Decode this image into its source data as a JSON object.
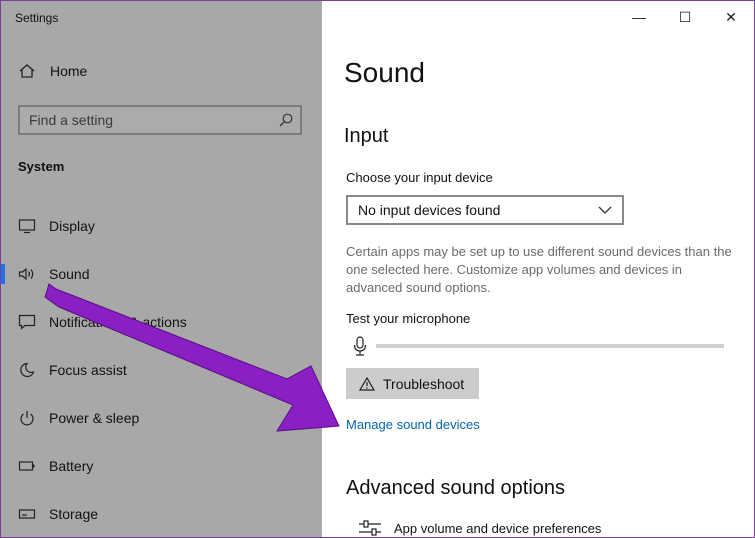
{
  "window": {
    "title": "Settings",
    "controls": {
      "minimize": "—",
      "maximize": "☐",
      "close": "✕"
    }
  },
  "sidebar": {
    "home": "Home",
    "search_placeholder": "Find a setting",
    "section": "System",
    "items": [
      {
        "label": "Display",
        "icon": "display-icon"
      },
      {
        "label": "Sound",
        "icon": "speaker-icon",
        "active": true
      },
      {
        "label": "Notifications & actions",
        "icon": "notification-icon"
      },
      {
        "label": "Focus assist",
        "icon": "moon-icon"
      },
      {
        "label": "Power & sleep",
        "icon": "power-icon"
      },
      {
        "label": "Battery",
        "icon": "battery-icon"
      },
      {
        "label": "Storage",
        "icon": "storage-icon"
      }
    ]
  },
  "main": {
    "title": "Sound",
    "input_heading": "Input",
    "choose_label": "Choose your input device",
    "select_value": "No input devices found",
    "description": "Certain apps may be set up to use different sound devices than the one selected here. Customize app volumes and devices in advanced sound options.",
    "test_label": "Test your microphone",
    "mic_level": 0,
    "troubleshoot": "Troubleshoot",
    "manage_link": "Manage sound devices",
    "advanced_heading": "Advanced sound options",
    "advanced_item": "App volume and device preferences"
  },
  "annotation": {
    "arrow_color": "#8a1fc4"
  }
}
